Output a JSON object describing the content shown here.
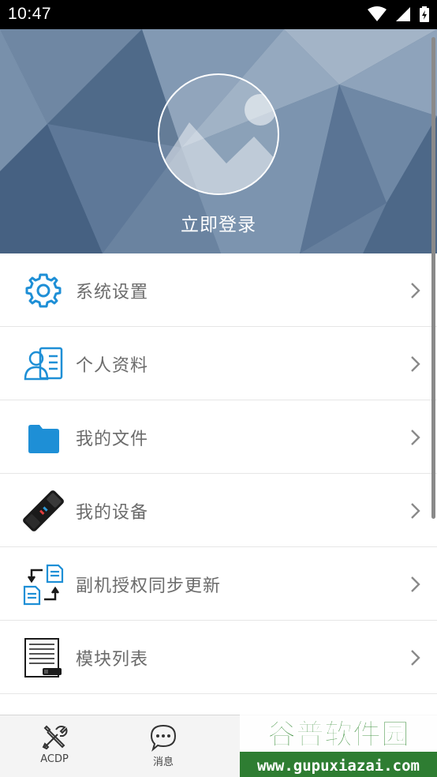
{
  "status_bar": {
    "time": "10:47"
  },
  "header": {
    "login_text": "立即登录"
  },
  "menu": [
    {
      "label": "系统设置",
      "icon": "gear-icon"
    },
    {
      "label": "个人资料",
      "icon": "profile-card-icon"
    },
    {
      "label": "我的文件",
      "icon": "folder-icon"
    },
    {
      "label": "我的设备",
      "icon": "device-icon"
    },
    {
      "label": "副机授权同步更新",
      "icon": "sync-documents-icon"
    },
    {
      "label": "模块列表",
      "icon": "module-list-icon"
    }
  ],
  "tabbar": {
    "tabs": [
      {
        "label": "ACDP",
        "icon": "tools-icon"
      },
      {
        "label": "消息",
        "icon": "message-bubble-icon"
      }
    ]
  },
  "watermark": {
    "title": "谷普软件园",
    "url": "www.gupuxiazai.com"
  },
  "colors": {
    "accent": "#1e8fd6",
    "header_bg": "#5a7391",
    "divider": "#e6e6e6"
  }
}
